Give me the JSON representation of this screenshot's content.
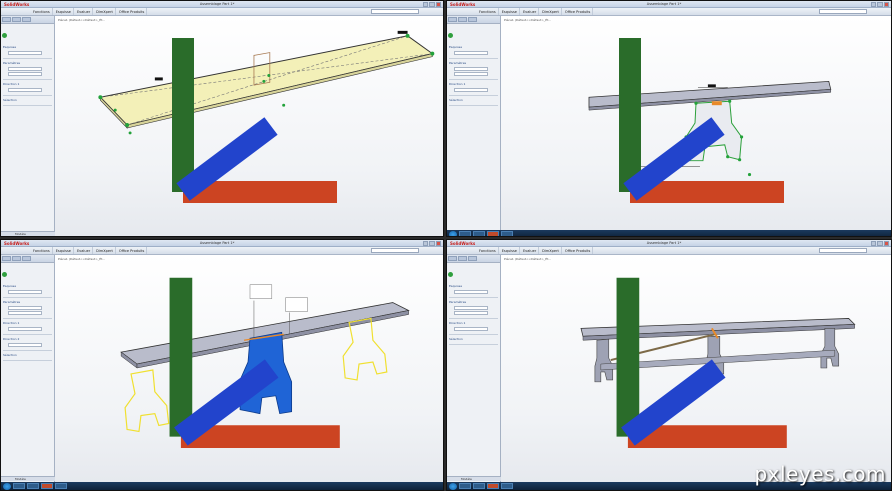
{
  "watermark": "pxleyes.com",
  "panes": [
    {
      "id": "top-left",
      "app_name": "SolidWorks",
      "document_title": "Assemblage Part 1*",
      "viewport_label": "Pièce1 (Défaut<<Défaut>_Ét...",
      "panel_sections": [
        "Esquisse",
        "Paramètres",
        "Direction 1",
        "Sélection"
      ],
      "bottom_tabs": [
        "Modèle",
        "Mouvement"
      ]
    },
    {
      "id": "top-right",
      "app_name": "SolidWorks",
      "document_title": "Assemblage Part 1*",
      "viewport_label": "Pièce1 (Défaut<<Défaut>_Ét...",
      "panel_sections": [
        "Esquisse",
        "Paramètres",
        "Direction 1",
        "Sélection"
      ],
      "bottom_tabs": [
        "Modèle",
        "Mouvement"
      ]
    },
    {
      "id": "bottom-left",
      "app_name": "SolidWorks",
      "document_title": "Assemblage Part 1*",
      "viewport_label": "Pièce1 (Défaut<<Défaut>_Ét...",
      "panel_sections": [
        "Esquisse",
        "Paramètres",
        "Direction 1",
        "Direction 2",
        "Sélection"
      ],
      "bottom_tabs": [
        "Modèle",
        "Mouvement"
      ]
    },
    {
      "id": "bottom-right",
      "app_name": "SolidWorks",
      "document_title": "Assemblage Part 1*",
      "viewport_label": "Pièce1 (Défaut<<Défaut>_Ét...",
      "panel_sections": [
        "Esquisse",
        "Paramètres",
        "Direction 1",
        "Sélection"
      ],
      "bottom_tabs": [
        "Modèle",
        "Mouvement"
      ]
    }
  ],
  "ribbon_tabs": [
    "Fonctions",
    "Esquisse",
    "Evaluer",
    "DimXpert",
    "Office Produits"
  ],
  "colors": {
    "plank_yellow": "#f3f0b8",
    "bench_grey": "#b9bccb",
    "leg_blue": "#1f64d6",
    "wire_yellow": "#f0e030",
    "sketch_green": "#22a23a"
  }
}
